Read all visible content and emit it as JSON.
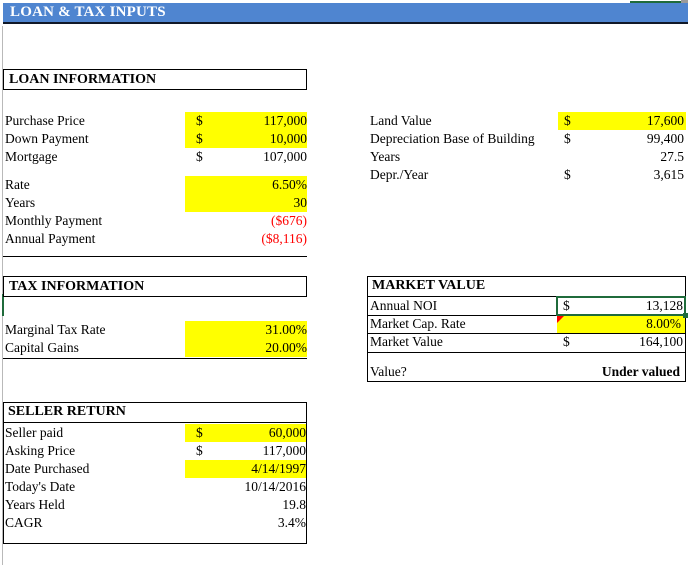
{
  "title_bar": {
    "text": "LOAN & TAX INPUTS",
    "background_color": "#4F85D0",
    "text_color": "#FFFFFF"
  },
  "colors": {
    "highlight_yellow": "#FFFF00",
    "negative_red": "#FF0000",
    "selection_green": "#1F6B3B",
    "title_blue": "#4F85D0"
  },
  "loan_information": {
    "heading": "LOAN INFORMATION",
    "rows": [
      {
        "label": "Purchase Price",
        "currency": "$",
        "value": "117,000",
        "highlighted": true
      },
      {
        "label": "Down Payment",
        "currency": "$",
        "value": "10,000",
        "highlighted": true
      },
      {
        "label": "Mortgage",
        "currency": "$",
        "value": "107,000",
        "highlighted": false
      },
      {
        "label": "Rate",
        "currency": "",
        "value": "6.50%",
        "highlighted": true
      },
      {
        "label": "Years",
        "currency": "",
        "value": "30",
        "highlighted": true
      },
      {
        "label": "Monthly Payment",
        "currency": "",
        "value": "($676)",
        "highlighted": false,
        "negative": true
      },
      {
        "label": "Annual Payment",
        "currency": "",
        "value": "($8,116)",
        "highlighted": false,
        "negative": true
      }
    ]
  },
  "depreciation": {
    "rows": [
      {
        "label": "Land Value",
        "currency": "$",
        "value": "17,600",
        "highlighted": true
      },
      {
        "label": "Depreciation Base of Building",
        "currency": "$",
        "value": "99,400",
        "highlighted": false
      },
      {
        "label": "Years",
        "currency": "",
        "value": "27.5",
        "highlighted": false
      },
      {
        "label": "Depr./Year",
        "currency": "$",
        "value": "3,615",
        "highlighted": false
      }
    ]
  },
  "tax_information": {
    "heading": "TAX INFORMATION",
    "rows": [
      {
        "label": "Marginal Tax Rate",
        "value": "31.00%",
        "highlighted": true
      },
      {
        "label": "Capital Gains",
        "value": "20.00%",
        "highlighted": true
      }
    ]
  },
  "market_value": {
    "heading": "MARKET VALUE",
    "rows": [
      {
        "label": "Annual NOI",
        "currency": "$",
        "value": "13,128",
        "highlighted": false,
        "selected": true
      },
      {
        "label": "Market Cap. Rate",
        "currency": "",
        "value": "8.00%",
        "highlighted": true,
        "has_comment": true
      },
      {
        "label": "Market Value",
        "currency": "$",
        "value": "164,100",
        "highlighted": false
      },
      {
        "label": "Value?",
        "currency": "",
        "value": "Under valued",
        "highlighted": false,
        "bold": true
      }
    ]
  },
  "seller_return": {
    "heading": "SELLER RETURN",
    "rows": [
      {
        "label": "Seller paid",
        "currency": "$",
        "value": "60,000",
        "highlighted": true
      },
      {
        "label": "Asking Price",
        "currency": "$",
        "value": "117,000",
        "highlighted": false
      },
      {
        "label": "Date Purchased",
        "currency": "",
        "value": "4/14/1997",
        "highlighted": true
      },
      {
        "label": "Today's Date",
        "currency": "",
        "value": "10/14/2016",
        "highlighted": false
      },
      {
        "label": "Years Held",
        "currency": "",
        "value": "19.8",
        "highlighted": false
      },
      {
        "label": "CAGR",
        "currency": "",
        "value": "3.4%",
        "highlighted": false
      }
    ]
  }
}
